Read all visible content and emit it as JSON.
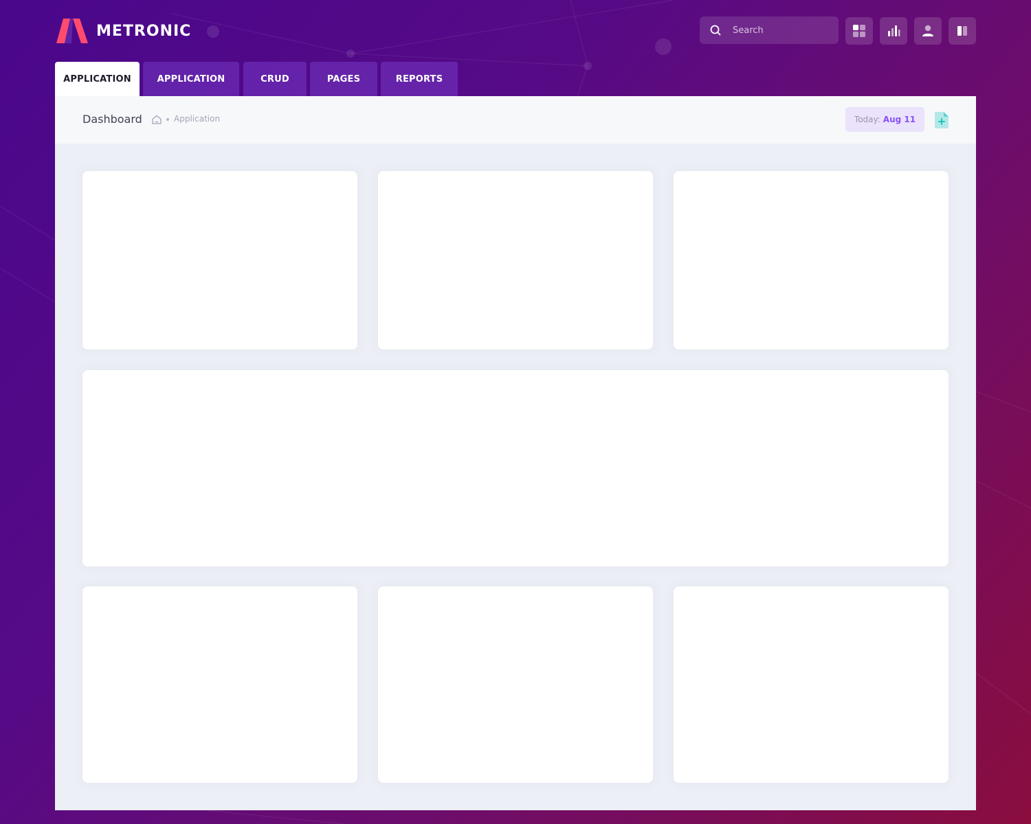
{
  "brand": {
    "name": "METRONIC",
    "logo_icon": "metronic-logo-icon",
    "accent": "#ff4b6e"
  },
  "search": {
    "placeholder": "Search",
    "icon": "search-icon"
  },
  "header_actions": [
    {
      "name": "apps-grid-button",
      "icon": "apps-grid-icon"
    },
    {
      "name": "stats-button",
      "icon": "bar-chart-icon"
    },
    {
      "name": "user-button",
      "icon": "user-icon"
    },
    {
      "name": "layout-toggle-button",
      "icon": "layout-columns-icon"
    }
  ],
  "tabs": [
    {
      "label": "APPLICATION",
      "active": true
    },
    {
      "label": "APPLICATION",
      "active": false
    },
    {
      "label": "CRUD",
      "active": false
    },
    {
      "label": "PAGES",
      "active": false
    },
    {
      "label": "REPORTS",
      "active": false
    }
  ],
  "subheader": {
    "title": "Dashboard",
    "breadcrumb": [
      "Application"
    ],
    "home_icon": "home-icon",
    "today_label": "Today:",
    "today_date": "Aug 11",
    "action_icon": "file-plus-icon"
  },
  "colors": {
    "background_start": "#4a078c",
    "background_end": "#8a0d3e",
    "content_bg": "#eceff6",
    "subheader_bg": "#f7f8fa",
    "primary": "#8950fc",
    "success": "#1bc5bd"
  }
}
